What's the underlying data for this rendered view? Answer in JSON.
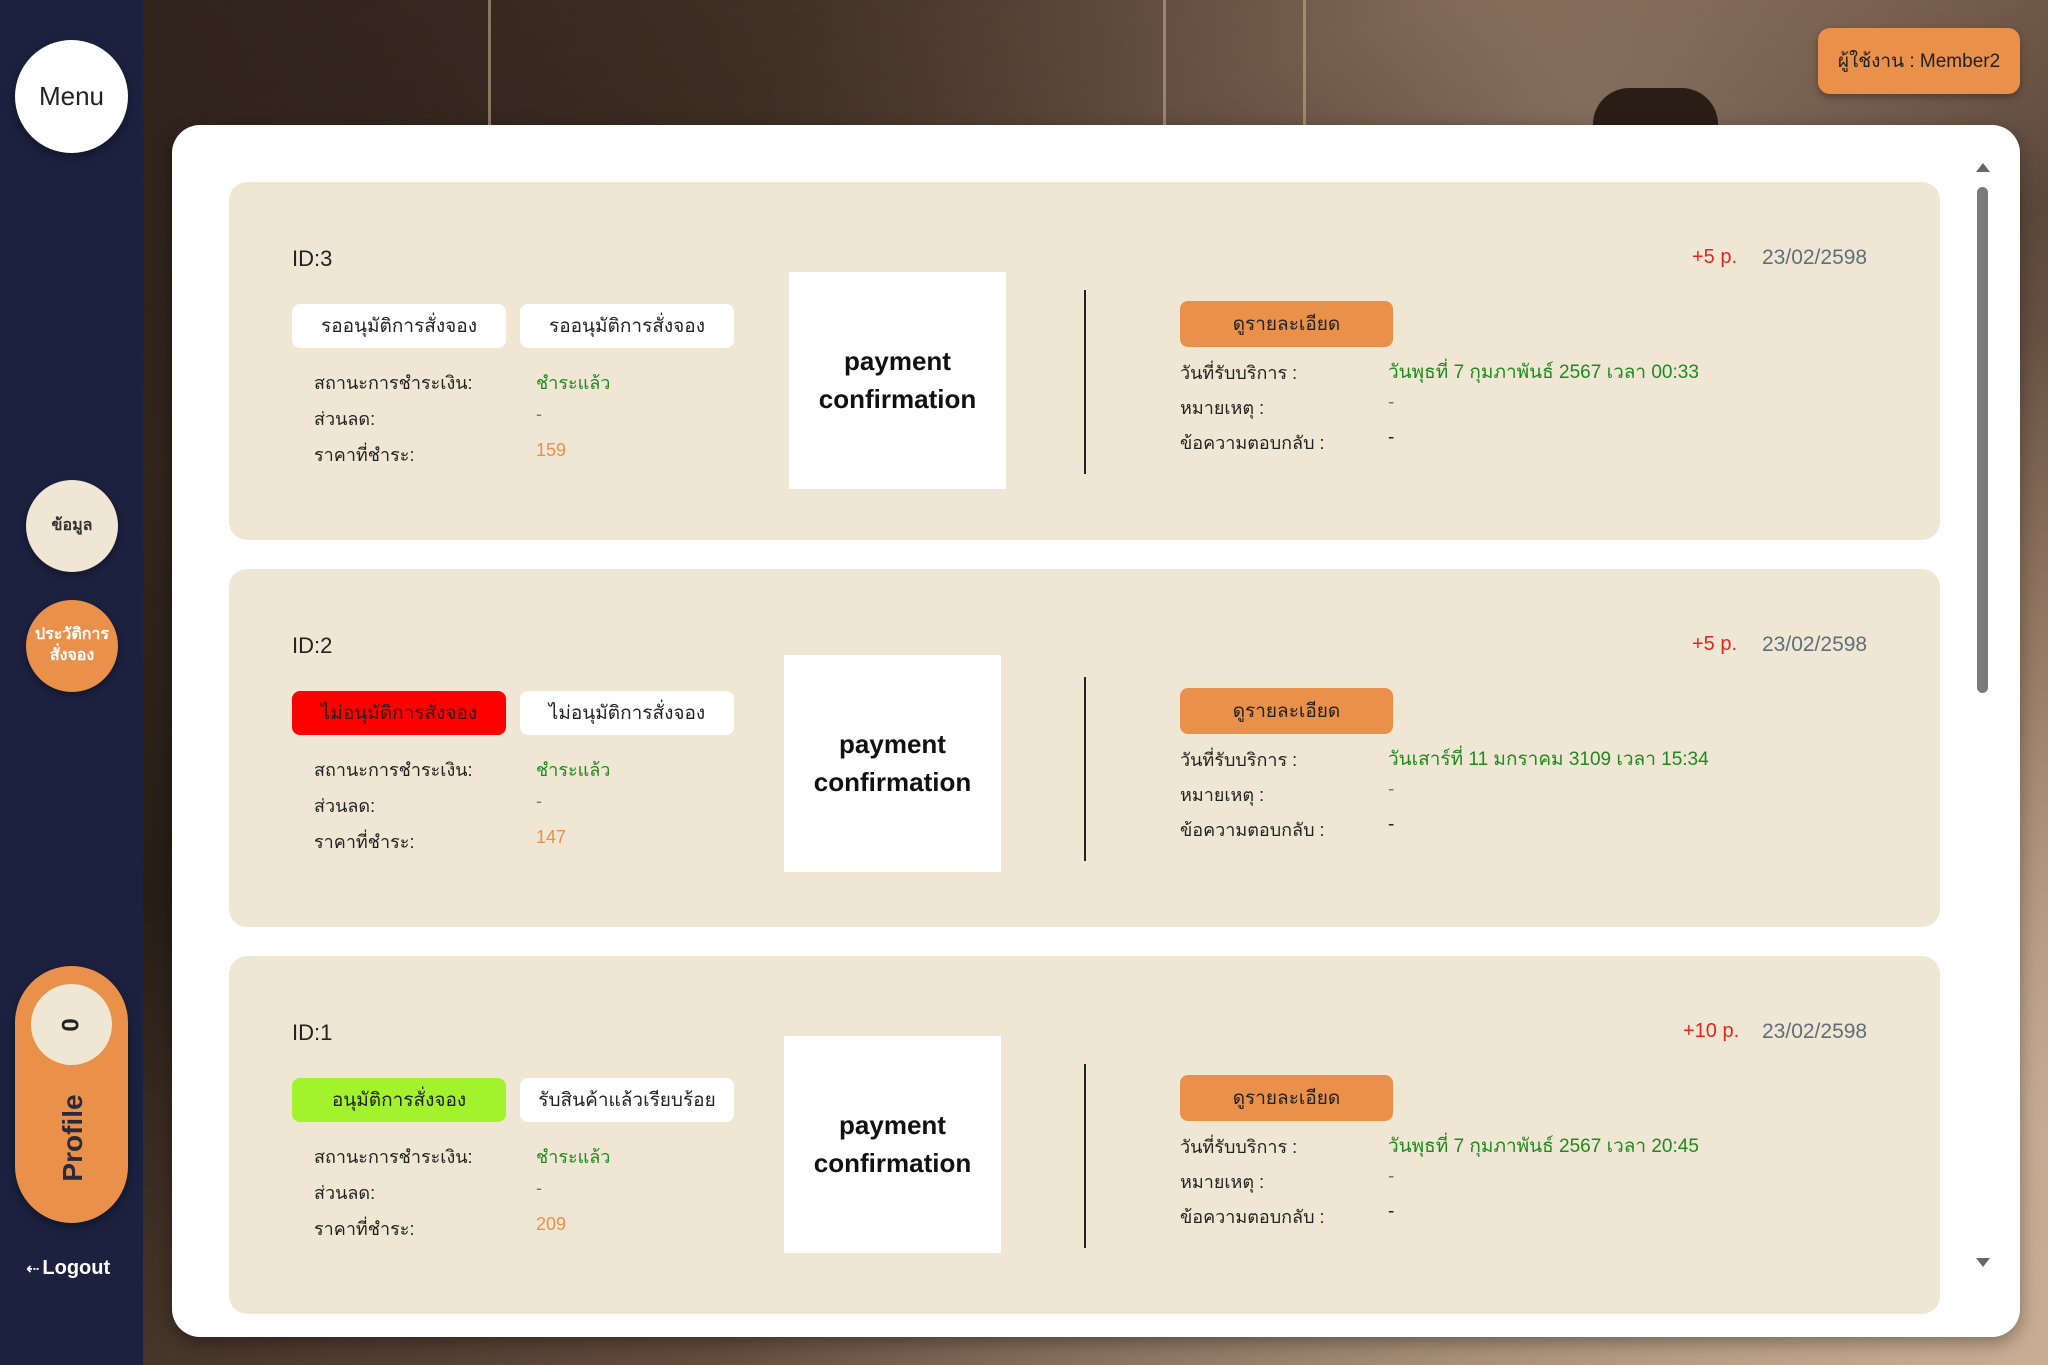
{
  "sidebar": {
    "menu_label": "Menu",
    "info_label": "ข้อมูล",
    "history_label": "ประวัติการสั่งจอง",
    "profile_count": "0",
    "profile_label": "Profile",
    "logout_label": "Logout"
  },
  "header": {
    "user_badge": "ผู้ใช้งาน : Member2"
  },
  "labels": {
    "payment_status": "สถานะการชำระเงิน:",
    "discount": "ส่วนลด:",
    "paid_price": "ราคาที่ชำระ:",
    "detail_button": "ดูรายละเอียด",
    "service_date": "วันที่รับบริการ :",
    "note": "หมายเหตุ :",
    "reply": "ข้อความตอบกลับ :",
    "payment_box": "payment confirmation"
  },
  "orders": [
    {
      "id": "ID:3",
      "points": "+5 p.",
      "date": "23/02/2598",
      "status_pill": "รออนุมัติการสั่งจอง",
      "state_pill": "รออนุมัติการสั่งจอง",
      "status_color": "#ffffff",
      "payment_status": "ชำระแล้ว",
      "discount": "-",
      "price": "159",
      "service_date": "วันพุธที่ 7 กุมภาพันธ์ 2567 เวลา 00:33",
      "note": "-",
      "reply": "-"
    },
    {
      "id": "ID:2",
      "points": "+5 p.",
      "date": "23/02/2598",
      "status_pill": "ไม่อนุมัติการสั่งจอง",
      "state_pill": "ไม่อนุมัติการสั่งจอง",
      "status_color": "#ff0000",
      "payment_status": "ชำระแล้ว",
      "discount": "-",
      "price": "147",
      "service_date": "วันเสาร์ที่ 11 มกราคม 3109 เวลา 15:34",
      "note": "-",
      "reply": "-"
    },
    {
      "id": "ID:1",
      "points": "+10 p.",
      "date": "23/02/2598",
      "status_pill": "อนุมัติการสั่งจอง",
      "state_pill": "รับสินค้าแล้วเรียบร้อย",
      "status_color": "#a2f22e",
      "payment_status": "ชำระแล้ว",
      "discount": "-",
      "price": "209",
      "service_date": "วันพุธที่ 7 กุมภาพันธ์ 2567 เวลา 20:45",
      "note": "-",
      "reply": "-"
    }
  ],
  "colors": {
    "sidebar_bg": "#1b213f",
    "accent_orange": "#e9904a",
    "card_bg": "#efe7d3",
    "paid_green": "#1e8a1e",
    "points_red": "#e3261f"
  }
}
